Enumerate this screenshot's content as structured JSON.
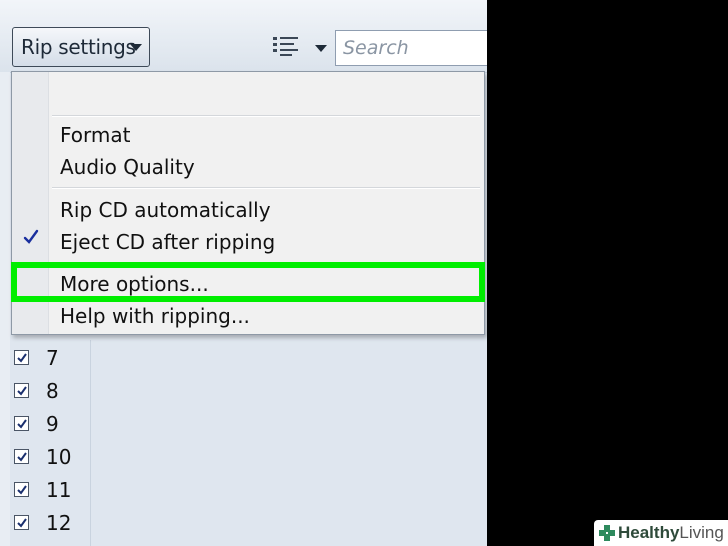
{
  "toolbar": {
    "rip_settings_label": "Rip settings",
    "search_placeholder": "Search"
  },
  "menu": {
    "items": [
      {
        "label": "Format"
      },
      {
        "label": "Audio Quality"
      },
      {
        "label": "Rip CD automatically"
      },
      {
        "label": "Eject CD after ripping",
        "checked": true
      },
      {
        "label": "More options...",
        "highlighted": true
      },
      {
        "label": "Help with ripping..."
      }
    ]
  },
  "tracks": [
    {
      "number": "7",
      "checked": true
    },
    {
      "number": "8",
      "checked": true
    },
    {
      "number": "9",
      "checked": true
    },
    {
      "number": "10",
      "checked": true
    },
    {
      "number": "11",
      "checked": true
    },
    {
      "number": "12",
      "checked": true
    }
  ],
  "highlight_color": "#00ee00",
  "watermark": {
    "brand_bold": "Healthy",
    "brand_regular": "Living"
  }
}
